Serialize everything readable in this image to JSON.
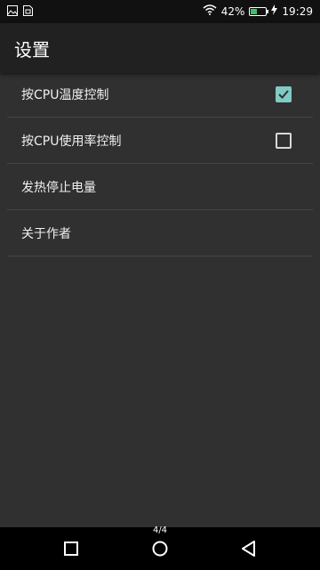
{
  "status_bar": {
    "battery_percent": "42%",
    "battery_level": 0.42,
    "time": "19:29",
    "icons": [
      "image-icon",
      "sim-card-icon",
      "wifi-icon",
      "battery-icon",
      "charging-icon"
    ]
  },
  "app_bar": {
    "title": "设置"
  },
  "settings": {
    "items": [
      {
        "label": "按CPU温度控制",
        "has_checkbox": true,
        "checked": true
      },
      {
        "label": "按CPU使用率控制",
        "has_checkbox": true,
        "checked": false
      },
      {
        "label": "发热停止电量",
        "has_checkbox": false
      },
      {
        "label": "关于作者",
        "has_checkbox": false
      }
    ]
  },
  "page_indicator": "4/4",
  "nav_bar": {
    "icons": [
      "recent-apps-icon",
      "home-icon",
      "back-icon"
    ]
  },
  "colors": {
    "background": "#303030",
    "app_bar": "#212121",
    "accent": "#80cbc4",
    "battery_fill": "#3cc26b"
  }
}
